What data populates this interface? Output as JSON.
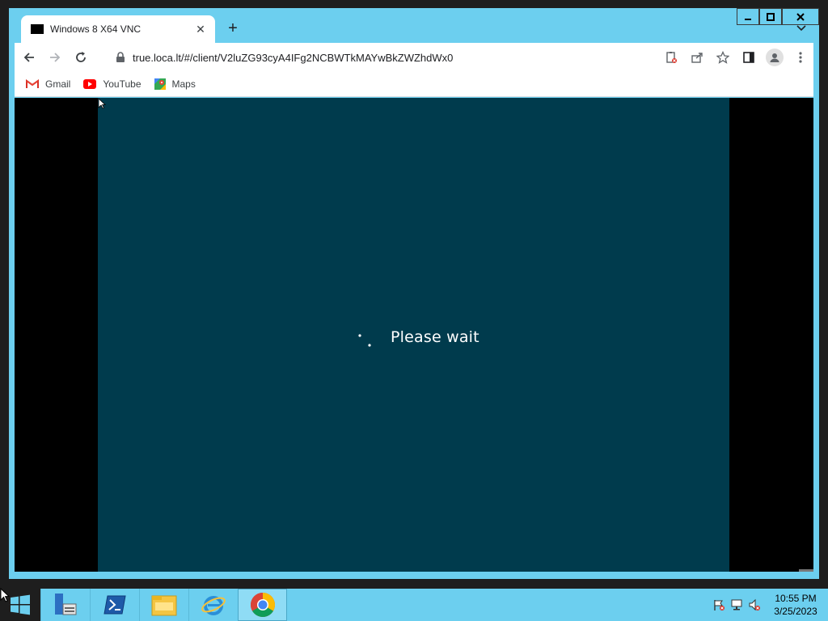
{
  "browser": {
    "tab": {
      "title": "Windows 8 X64 VNC"
    },
    "url": "true.loca.lt/#/client/V2luZG93cyA4IFg2NCBWTkMAYwBkZWZhdWx0",
    "bookmarks": [
      {
        "label": "Gmail",
        "icon": "gmail-icon"
      },
      {
        "label": "YouTube",
        "icon": "youtube-icon"
      },
      {
        "label": "Maps",
        "icon": "maps-icon"
      }
    ]
  },
  "vnc": {
    "status_text": "Please wait",
    "background_color": "#003b4d"
  },
  "taskbar": {
    "items": [
      "server-manager-icon",
      "powershell-icon",
      "file-explorer-icon",
      "internet-explorer-icon",
      "chrome-icon"
    ],
    "active_item": "chrome-icon",
    "clock": {
      "time": "10:55 PM",
      "date": "3/25/2023"
    }
  },
  "colors": {
    "window_frame": "#6ccfef",
    "taskbar": "#6ccfef",
    "desktop": "#1e1e1e"
  }
}
